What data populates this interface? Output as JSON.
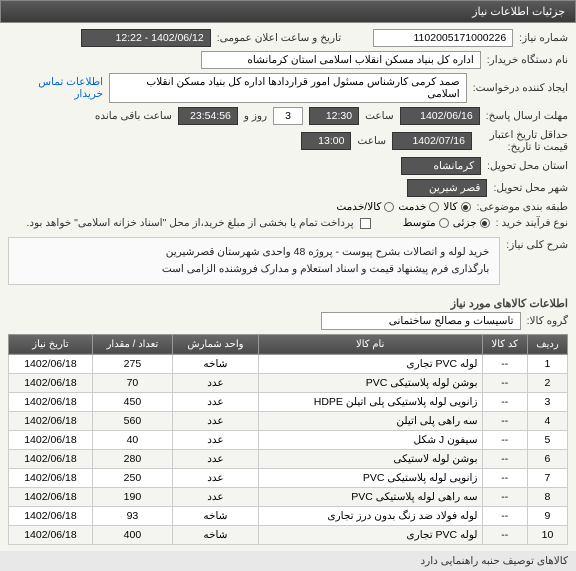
{
  "header": {
    "title": "جزئیات اطلاعات نیاز"
  },
  "form": {
    "need_number_label": "شماره نیاز:",
    "need_number": "1102005171000226",
    "announce_label": "تاریخ و ساعت اعلان عمومی:",
    "announce_value": "1402/06/12 - 12:22",
    "buyer_label": "نام دستگاه خریدار:",
    "buyer_value": "اداره کل بنیاد مسکن انقلاب اسلامی استان کرمانشاه",
    "creator_label": "ایجاد کننده درخواست:",
    "creator_value": "صمد کرمی کارشناس مسئول امور قراردادها اداره کل بنیاد مسکن انقلاب اسلامی",
    "contact_link": "اطلاعات تماس خریدار",
    "deadline_label": "مهلت ارسال پاسخ:",
    "deadline_date": "1402/06/16",
    "time_label": "ساعت",
    "deadline_time": "12:30",
    "days_count": "3",
    "days_label": "روز و",
    "remaining_time": "23:54:56",
    "remaining_label": "ساعت باقی مانده",
    "validity_label": "حداقل تاریخ اعتبار قیمت تا تاریخ:",
    "validity_date": "1402/07/16",
    "validity_time": "13:00",
    "province_label": "استان محل تحویل:",
    "province": "کرمانشاه",
    "city_label": "شهر محل تحویل:",
    "city": "قصر شیرین",
    "classify_label": "طبقه بندی موضوعی:",
    "class_goods": "کالا",
    "class_service": "خدمت",
    "class_goods_service": "کالا/خدمت",
    "process_label": "نوع فرآیند خرید :",
    "proc_small": "جزئی",
    "proc_medium": "متوسط",
    "payment_note": "پرداخت تمام یا بخشی از مبلغ خرید،از محل \"اسناد خزانه اسلامی\" خواهد بود.",
    "desc_label": "شرح کلی نیاز:",
    "desc_line1": "خرید لوله و اتصالات بشرح پیوست - پروژه 48 واحدی شهرستان قصرشیرین",
    "desc_line2": "بارگذاری فرم پیشنهاد قیمت و اسناد استعلام و مدارک فروشنده الزامی است",
    "items_header": "اطلاعات کالاهای مورد نیاز",
    "group_label": "گروه کالا:",
    "group_value": "تاسیسات و مصالح ساختمانی"
  },
  "table": {
    "headers": {
      "row": "ردیف",
      "code": "کد کالا",
      "name": "نام کالا",
      "unit": "واحد شمارش",
      "qty": "تعداد / مقدار",
      "date": "تاریخ نیاز"
    },
    "rows": [
      {
        "n": "1",
        "code": "--",
        "name": "لوله PVC تجاری",
        "unit": "شاخه",
        "qty": "275",
        "date": "1402/06/18"
      },
      {
        "n": "2",
        "code": "--",
        "name": "بوشن لوله پلاستیکی PVC",
        "unit": "عدد",
        "qty": "70",
        "date": "1402/06/18"
      },
      {
        "n": "3",
        "code": "--",
        "name": "زانویی لوله پلاستیکی پلی اتیلن HDPE",
        "unit": "عدد",
        "qty": "450",
        "date": "1402/06/18"
      },
      {
        "n": "4",
        "code": "--",
        "name": "سه راهی پلی اتیلن",
        "unit": "عدد",
        "qty": "560",
        "date": "1402/06/18"
      },
      {
        "n": "5",
        "code": "--",
        "name": "سیفون J شکل",
        "unit": "عدد",
        "qty": "40",
        "date": "1402/06/18"
      },
      {
        "n": "6",
        "code": "--",
        "name": "بوشن لوله لاستیکی",
        "unit": "عدد",
        "qty": "280",
        "date": "1402/06/18"
      },
      {
        "n": "7",
        "code": "--",
        "name": "زانویی لوله پلاستیکی PVC",
        "unit": "عدد",
        "qty": "250",
        "date": "1402/06/18"
      },
      {
        "n": "8",
        "code": "--",
        "name": "سه راهی لوله پلاستیکی PVC",
        "unit": "عدد",
        "qty": "190",
        "date": "1402/06/18"
      },
      {
        "n": "9",
        "code": "--",
        "name": "لوله فولاد ضد زنگ بدون درز تجاری",
        "unit": "شاخه",
        "qty": "93",
        "date": "1402/06/18"
      },
      {
        "n": "10",
        "code": "--",
        "name": "لوله PVC تجاری",
        "unit": "شاخه",
        "qty": "400",
        "date": "1402/06/18"
      }
    ]
  },
  "footer": {
    "note": "کالاهای توصیف حنبه راهنمایی دارد"
  }
}
